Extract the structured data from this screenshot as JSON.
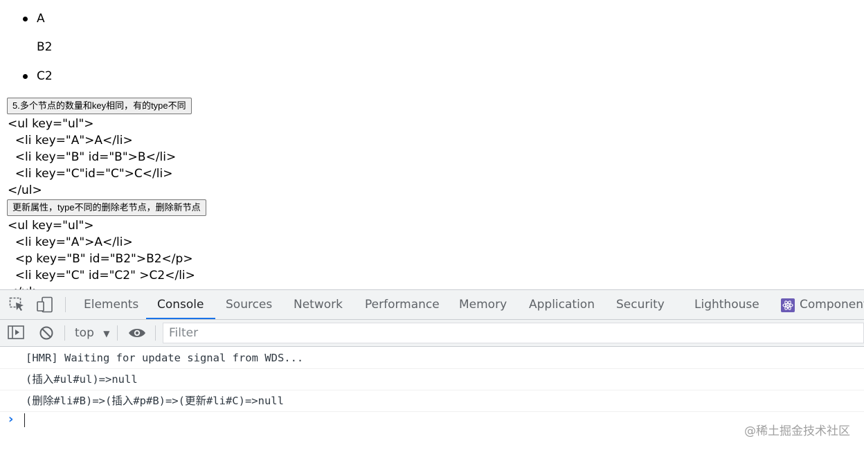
{
  "preview": {
    "list": [
      {
        "text": "A",
        "bullet": true
      },
      {
        "text": "B2",
        "bullet": false
      },
      {
        "text": "C2",
        "bullet": true
      }
    ],
    "button1": "5.多个节点的数量和key相同，有的type不同",
    "code1": [
      "<ul key=\"ul\">",
      "  <li key=\"A\">A</li>",
      "  <li key=\"B\" id=\"B\">B</li>",
      "  <li key=\"C\"id=\"C\">C</li>",
      "</ul>"
    ],
    "button2": "更新属性，type不同的删除老节点，删除新节点",
    "code2": [
      "<ul key=\"ul\">",
      "  <li key=\"A\">A</li>",
      "  <p key=\"B\" id=\"B2\">B2</p>",
      "  <li key=\"C\" id=\"C2\" >C2</li>",
      "</ul>"
    ]
  },
  "devtools": {
    "tabs": [
      "Elements",
      "Console",
      "Sources",
      "Network",
      "Performance",
      "Memory",
      "Application",
      "Security",
      "Lighthouse",
      "Components"
    ],
    "active_tab": "Console",
    "context": "top",
    "filter_placeholder": "Filter",
    "messages": [
      "[HMR] Waiting for update signal from WDS...",
      "(插入#ul#ul)=>null",
      "(删除#li#B)=>(插入#p#B)=>(更新#li#C)=>null"
    ],
    "prompt_symbol": "›"
  },
  "watermark": "@稀土掘金技术社区",
  "colors": {
    "accent": "#1a73e8",
    "toolbar_bg": "#f1f3f4"
  }
}
